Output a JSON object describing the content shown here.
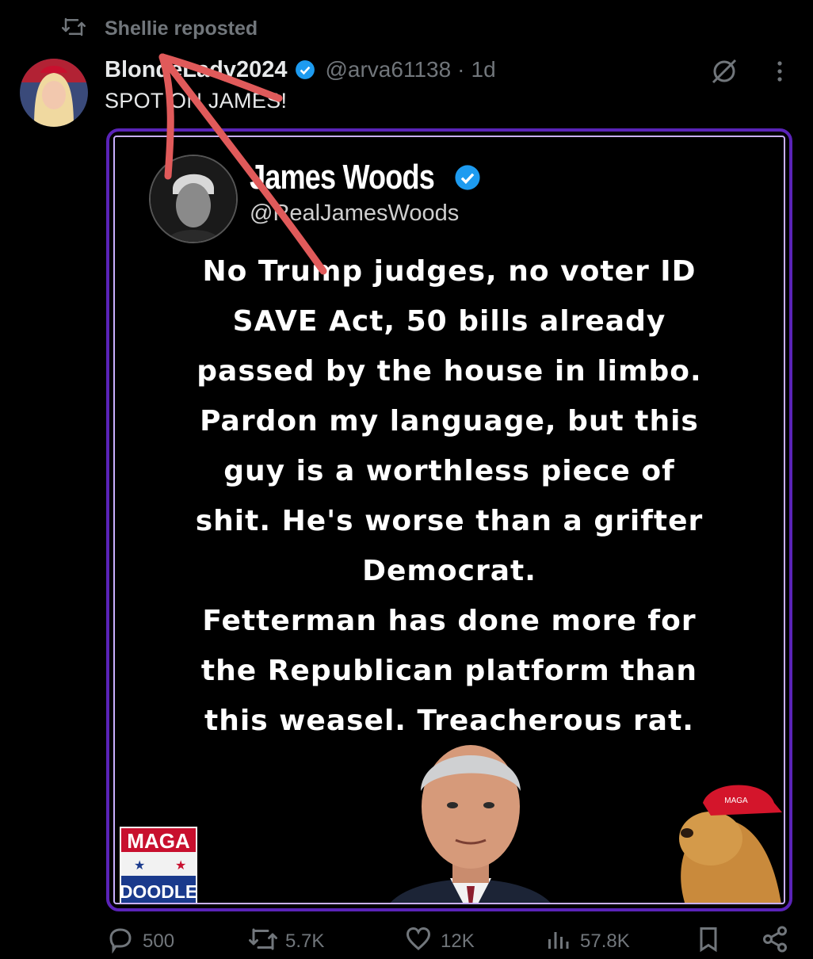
{
  "repost": {
    "label": "Shellie reposted"
  },
  "author": {
    "name": "BlondeLady2024",
    "handle": "@arva61138",
    "time": "1d"
  },
  "tweet": {
    "text": "SPOT ON JAMES!"
  },
  "quote_card": {
    "name": "James Woods",
    "handle": "@RealJamesWoods",
    "lines": [
      "No Trump judges, no voter ID",
      "SAVE Act, 50 bills already",
      "passed by the house in limbo.",
      "Pardon my language, but this",
      "guy is a worthless piece of",
      "shit. He's worse than a grifter",
      "Democrat.",
      "Fetterman has done more for",
      "the Republican platform than",
      "this weasel. Treacherous rat."
    ],
    "logo_maga": "MAGA",
    "logo_doodle": "DOODLE"
  },
  "actions": {
    "replies": "500",
    "reposts": "5.7K",
    "likes": "12K",
    "views": "57.8K"
  },
  "colors": {
    "verified": "#1d9bf0",
    "media_border": "#5a23b8",
    "annotation": "#e05a5a",
    "muted": "#71767b"
  },
  "icons": [
    "repost-icon",
    "verified-icon",
    "grok-icon",
    "more-icon",
    "reply-icon",
    "like-icon",
    "views-icon",
    "bookmark-icon",
    "share-icon"
  ]
}
